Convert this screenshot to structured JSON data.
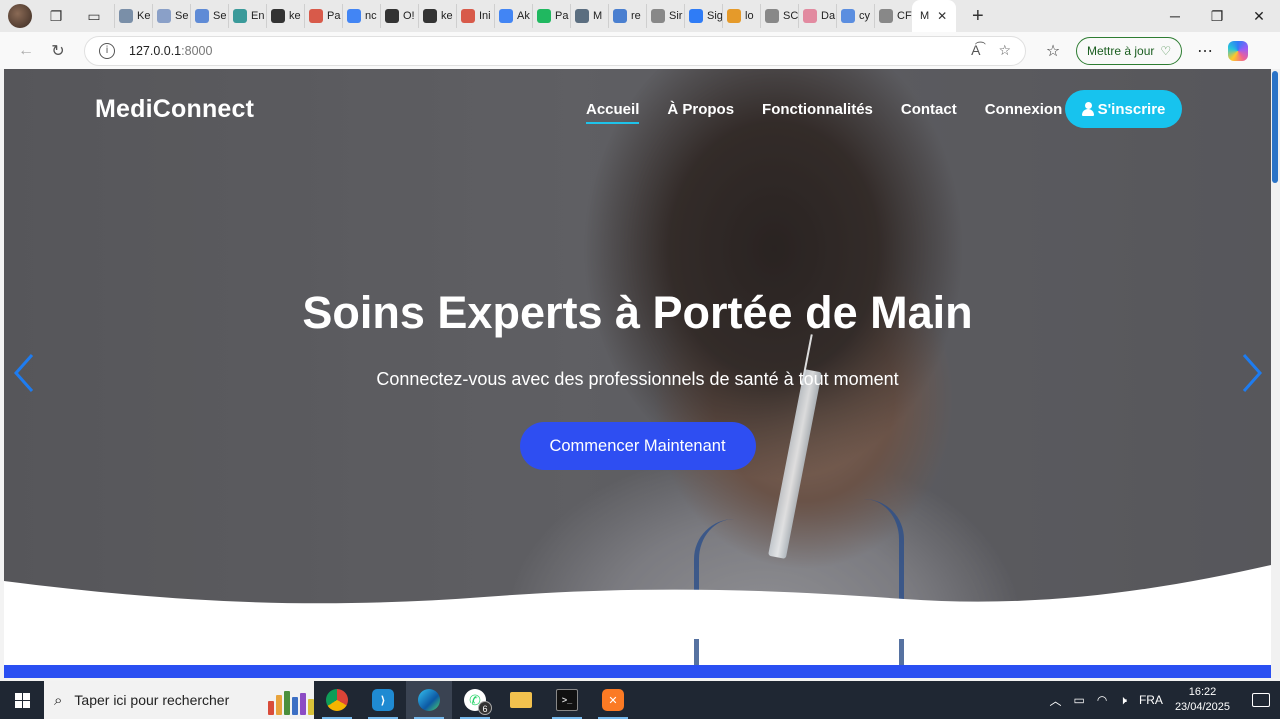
{
  "browser": {
    "tabs": [
      {
        "label": "Ke",
        "color": "#7a8fa8"
      },
      {
        "label": "Se",
        "color": "#8aa0c8"
      },
      {
        "label": "Se",
        "color": "#5f8bd6"
      },
      {
        "label": "En",
        "color": "#3a9a9a"
      },
      {
        "label": "ke",
        "color": "#333333"
      },
      {
        "label": "Pa",
        "color": "#d85a4a"
      },
      {
        "label": "nc",
        "color": "#4285f4"
      },
      {
        "label": "O!",
        "color": "#333333"
      },
      {
        "label": "ke",
        "color": "#333333"
      },
      {
        "label": "Ini",
        "color": "#d85a4a"
      },
      {
        "label": "Ak",
        "color": "#4285f4"
      },
      {
        "label": "Pa",
        "color": "#20b860"
      },
      {
        "label": "M",
        "color": "#5b6e80"
      },
      {
        "label": "re",
        "color": "#4a7fd0"
      },
      {
        "label": "Sir",
        "color": "#888888"
      },
      {
        "label": "Sig",
        "color": "#2f7cf6"
      },
      {
        "label": "lo",
        "color": "#e59a2a"
      },
      {
        "label": "SC",
        "color": "#888888"
      },
      {
        "label": "Da",
        "color": "#e28aa0"
      },
      {
        "label": "cy",
        "color": "#5b8ee0"
      },
      {
        "label": "CF",
        "color": "#888888"
      }
    ],
    "active_tab": {
      "label": "M",
      "close": "✕"
    },
    "new_tab": "+",
    "url_host": "127.0.0.1",
    "url_port": ":8000",
    "update_button": "Mettre à jour"
  },
  "site": {
    "brand": "MediConnect",
    "nav": [
      "Accueil",
      "À Propos",
      "Fonctionnalités",
      "Contact",
      "Connexion"
    ],
    "signup": "S'inscrire",
    "hero_title": "Soins Experts à Portée de Main",
    "hero_subtitle": "Connectez-vous avec des professionnels de santé à tout moment",
    "cta": "Commencer Maintenant",
    "accent": "#17c3ee",
    "primary": "#2e4ef2"
  },
  "taskbar": {
    "search_placeholder": "Taper ici pour rechercher",
    "whatsapp_badge": "6",
    "language": "FRA",
    "time": "16:22",
    "date": "23/04/2025"
  }
}
